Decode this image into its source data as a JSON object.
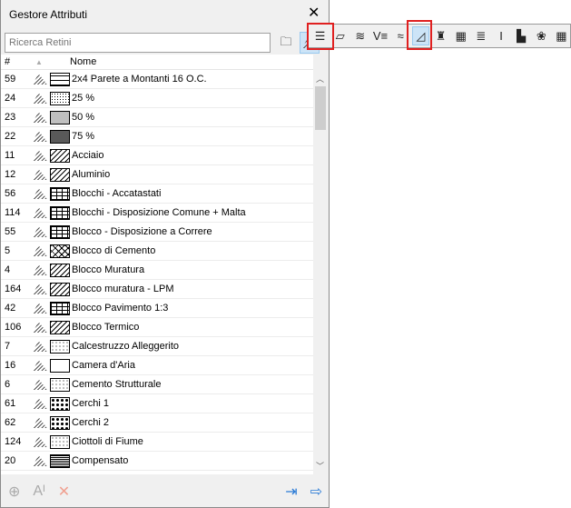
{
  "window": {
    "title": "Gestore Attributi",
    "close": "✕"
  },
  "search": {
    "placeholder": "Ricerca Retini"
  },
  "header": {
    "num": "#",
    "sort": "▲",
    "name": "Nome"
  },
  "rows": [
    {
      "id": "59",
      "name": "2x4 Parete a Montanti 16 O.C.",
      "p": "p0"
    },
    {
      "id": "24",
      "name": "25 %",
      "p": "p1"
    },
    {
      "id": "23",
      "name": "50 %",
      "p": "p2"
    },
    {
      "id": "22",
      "name": "75 %",
      "p": "p3"
    },
    {
      "id": "11",
      "name": "Acciaio",
      "p": "p4"
    },
    {
      "id": "12",
      "name": "Aluminio",
      "p": "p4"
    },
    {
      "id": "56",
      "name": "Blocchi - Accatastati",
      "p": "p5"
    },
    {
      "id": "114",
      "name": "Blocchi - Disposizione Comune + Malta",
      "p": "p5"
    },
    {
      "id": "55",
      "name": "Blocco - Disposizione a Correre",
      "p": "p5"
    },
    {
      "id": "5",
      "name": "Blocco di Cemento",
      "p": "p6"
    },
    {
      "id": "4",
      "name": "Blocco Muratura",
      "p": "p4"
    },
    {
      "id": "164",
      "name": "Blocco muratura - LPM",
      "p": "p4"
    },
    {
      "id": "42",
      "name": "Blocco Pavimento 1:3",
      "p": "p5"
    },
    {
      "id": "106",
      "name": "Blocco Termico",
      "p": "p4"
    },
    {
      "id": "7",
      "name": "Calcestruzzo Alleggerito",
      "p": "p9"
    },
    {
      "id": "16",
      "name": "Camera d'Aria",
      "p": "p7"
    },
    {
      "id": "6",
      "name": "Cemento Strutturale",
      "p": "p9"
    },
    {
      "id": "61",
      "name": "Cerchi 1",
      "p": "p8"
    },
    {
      "id": "62",
      "name": "Cerchi 2",
      "p": "p8"
    },
    {
      "id": "124",
      "name": "Ciottoli di Fiume",
      "p": "p9"
    },
    {
      "id": "20",
      "name": "Compensato",
      "p": "p10"
    }
  ],
  "toolbar": [
    "☰",
    "▱",
    "≋",
    "V≡",
    "≈",
    "◿",
    "♜",
    "▦",
    "≣",
    "I",
    "▙",
    "❀",
    "▦"
  ]
}
